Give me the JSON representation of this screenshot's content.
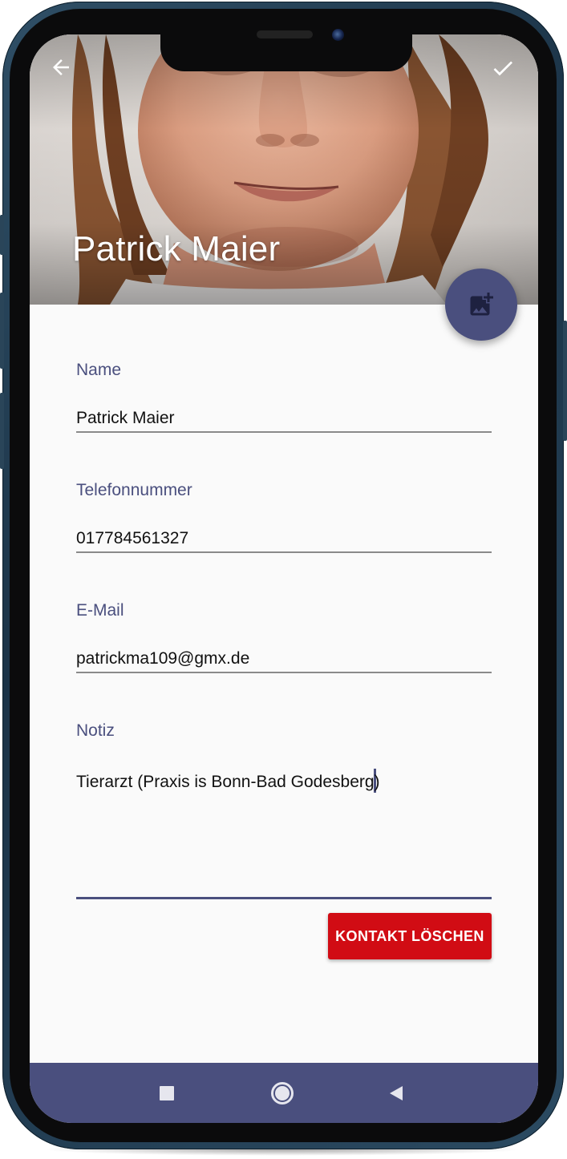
{
  "app": {
    "contact_title": "Patrick Maier"
  },
  "header": {
    "back_icon": "arrow-back-icon",
    "confirm_icon": "checkmark-icon",
    "photo_button_icon": "add-photo-icon"
  },
  "form": {
    "name": {
      "label": "Name",
      "value": "Patrick Maier"
    },
    "phone": {
      "label": "Telefonnummer",
      "value": "017784561327"
    },
    "email": {
      "label": "E-Mail",
      "value": "patrickma109@gmx.de"
    },
    "note": {
      "label": "Notiz",
      "value_before_caret": "Tierarzt (Praxis is Bonn-Bad Godesberg",
      "value_after_caret": ")"
    }
  },
  "actions": {
    "delete_label": "KONTAKT LÖSCHEN"
  },
  "navbar": {
    "recents_icon": "square-recents-icon",
    "home_icon": "circle-home-icon",
    "back_icon": "triangle-back-icon"
  },
  "colors": {
    "accent": "#4a4f7e",
    "danger": "#d10c14",
    "navbar": "#4a4f7e",
    "background": "#fafafa"
  }
}
